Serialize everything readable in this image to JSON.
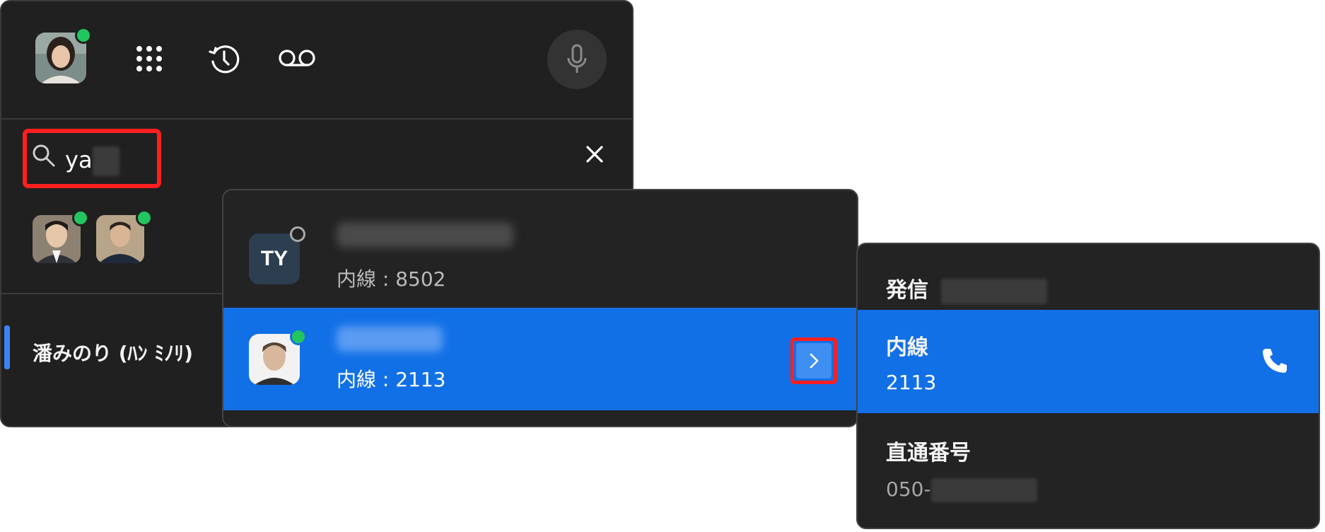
{
  "main": {
    "search": {
      "query": "ya"
    },
    "current_contact": {
      "name": "潘みのり (ﾊﾝ ﾐﾉﾘ)"
    },
    "icons": {
      "dialpad": "dialpad-icon",
      "history": "history-icon",
      "voicemail": "voicemail-icon",
      "mic": "microphone-icon",
      "search": "search-icon",
      "close": "close-icon"
    }
  },
  "results": [
    {
      "initials": "TY",
      "ext_label": "内線 : 8502",
      "presence": "offline"
    },
    {
      "initials": "",
      "ext_label": "内線 : 2113",
      "presence": "online"
    }
  ],
  "call_panel": {
    "title": "発信",
    "ext_label": "内線",
    "ext_value": "2113",
    "direct_label": "直通番号",
    "direct_value": "050-"
  },
  "colors": {
    "panel_bg": "#202020",
    "selected_bg": "#1270e6",
    "online": "#22c55e",
    "highlight": "#ff1f1f",
    "accent": "#3b82f6"
  }
}
